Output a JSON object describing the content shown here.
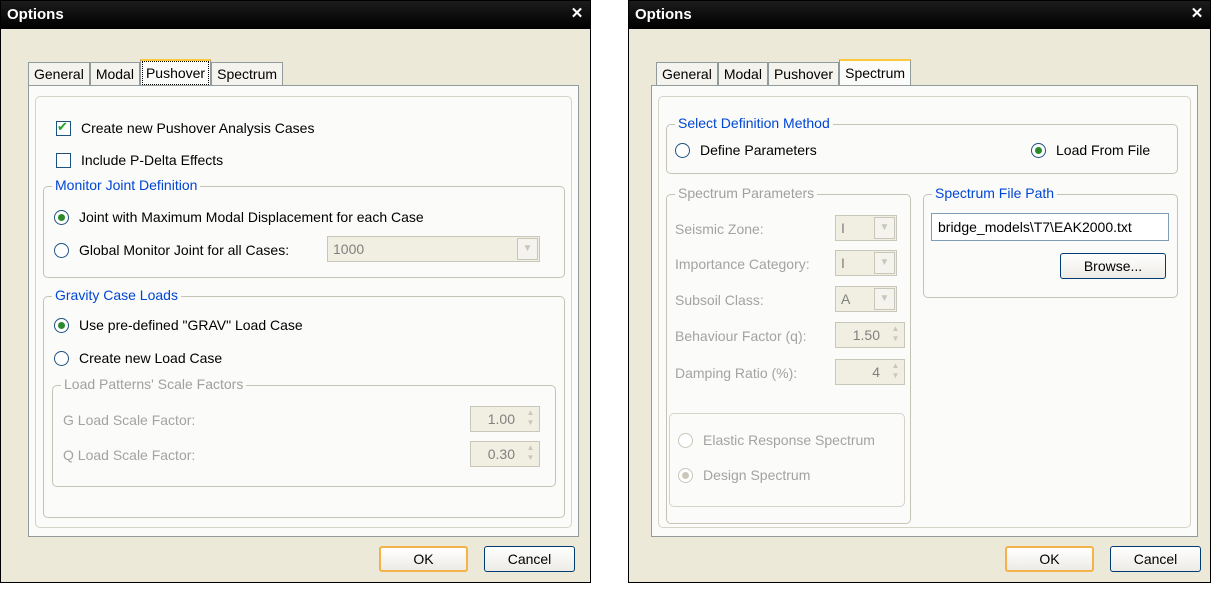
{
  "left_dialog": {
    "title": "Options",
    "close_glyph": "✕",
    "tabs": [
      "General",
      "Modal",
      "Pushover",
      "Spectrum"
    ],
    "active_tab": "Pushover",
    "create_pushover_label": "Create new Pushover Analysis Cases",
    "create_pushover_checked": true,
    "pdelta_label": "Include P-Delta Effects",
    "pdelta_checked": false,
    "monitor_group": {
      "legend": "Monitor Joint Definition",
      "option1": "Joint with Maximum Modal Displacement for each Case",
      "option2": "Global Monitor Joint for all Cases:",
      "selected": 1,
      "joint_value": "1000"
    },
    "gravity_group": {
      "legend": "Gravity Case Loads",
      "option1": "Use pre-defined \"GRAV\" Load Case",
      "option2": "Create new Load Case",
      "selected": 1
    },
    "scale_group": {
      "legend": "Load Patterns' Scale Factors",
      "g_label": "G Load Scale Factor:",
      "g_value": "1.00",
      "q_label": "Q Load Scale Factor:",
      "q_value": "0.30"
    },
    "ok_label": "OK",
    "cancel_label": "Cancel"
  },
  "right_dialog": {
    "title": "Options",
    "close_glyph": "✕",
    "tabs": [
      "General",
      "Modal",
      "Pushover",
      "Spectrum"
    ],
    "active_tab": "Spectrum",
    "method_group": {
      "legend": "Select Definition Method",
      "option1": "Define Parameters",
      "option2": "Load From File",
      "selected": 2
    },
    "params_group": {
      "legend": "Spectrum Parameters",
      "seismic_zone_label": "Seismic Zone:",
      "seismic_zone_value": "I",
      "importance_label": "Importance Category:",
      "importance_value": "I",
      "subsoil_label": "Subsoil Class:",
      "subsoil_value": "A",
      "behaviour_label": "Behaviour Factor (q):",
      "behaviour_value": "1.50",
      "damping_label": "Damping Ratio (%):",
      "damping_value": "4",
      "elastic_label": "Elastic Response Spectrum",
      "design_label": "Design Spectrum",
      "spectrum_selected": 2
    },
    "file_group": {
      "legend": "Spectrum File Path",
      "path": "bridge_models\\T7\\EAK2000.txt",
      "browse_label": "Browse..."
    },
    "ok_label": "OK",
    "cancel_label": "Cancel"
  }
}
